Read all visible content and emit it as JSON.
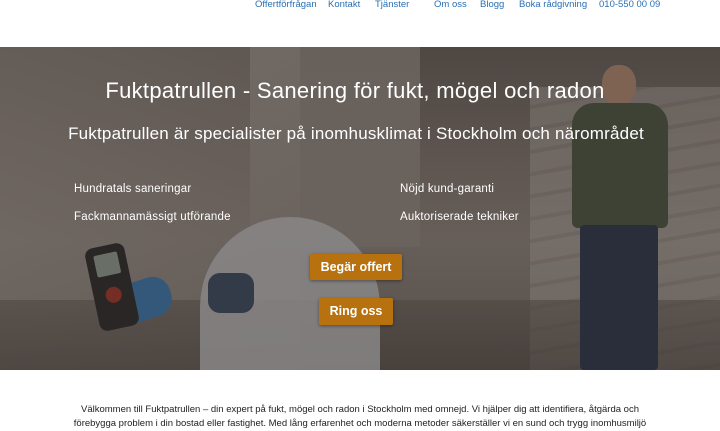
{
  "nav": {
    "items": [
      "Offertförfrågan",
      "Kontakt",
      "Tjänster",
      "Om oss",
      "Blogg",
      "Boka rådgivning",
      "010-550 00 09"
    ]
  },
  "hero": {
    "title": "Fuktpatrullen - Sanering för fukt, mögel och radon",
    "subtitle": "Fuktpatrullen är specialister på inomhusklimat i Stockholm och närområdet",
    "features_left": [
      "Hundratals saneringar",
      "Fackmannamässigt utförande"
    ],
    "features_right": [
      "Nöjd kund-garanti",
      "Auktoriserade tekniker"
    ],
    "cta_primary": "Begär offert",
    "cta_secondary": "Ring oss"
  },
  "intro": {
    "line1": "Välkommen till Fuktpatrullen – din expert på fukt, mögel och radon i Stockholm med omnejd. Vi hjälper dig att identifiera, åtgärda och",
    "line2": "förebygga problem i din bostad eller fastighet. Med lång erfarenhet och moderna metoder säkerställer vi en sund och trygg inomhusmiljö"
  },
  "colors": {
    "nav_link": "#2a6fb3",
    "cta_background": "#b7720f",
    "hero_text": "#ffffff",
    "body_text": "#222222"
  }
}
